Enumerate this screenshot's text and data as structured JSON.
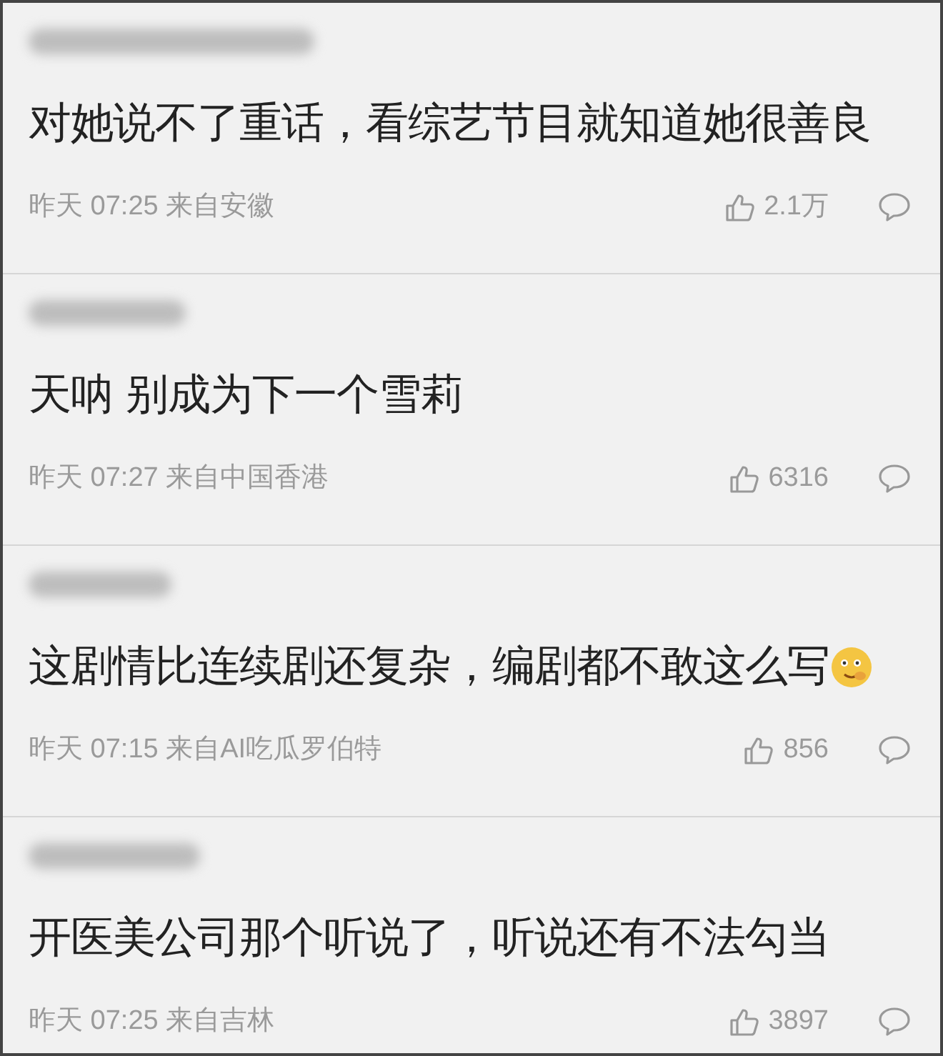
{
  "comments": [
    {
      "text": "对她说不了重话，看综艺节目就知道她很善良",
      "emoji": false,
      "day": "昨天",
      "time": "07:25",
      "location": "来自安徽",
      "likes": "2.1万"
    },
    {
      "text": "天呐 别成为下一个雪莉",
      "emoji": false,
      "day": "昨天",
      "time": "07:27",
      "location": "来自中国香港",
      "likes": "6316"
    },
    {
      "text": "这剧情比连续剧还复杂，编剧都不敢这么写",
      "emoji": true,
      "day": "昨天",
      "time": "07:15",
      "location": "来自AI吃瓜罗伯特",
      "likes": "856"
    },
    {
      "text": "开医美公司那个听说了，听说还有不法勾当",
      "emoji": false,
      "day": "昨天",
      "time": "07:25",
      "location": "来自吉林",
      "likes": "3897"
    }
  ]
}
